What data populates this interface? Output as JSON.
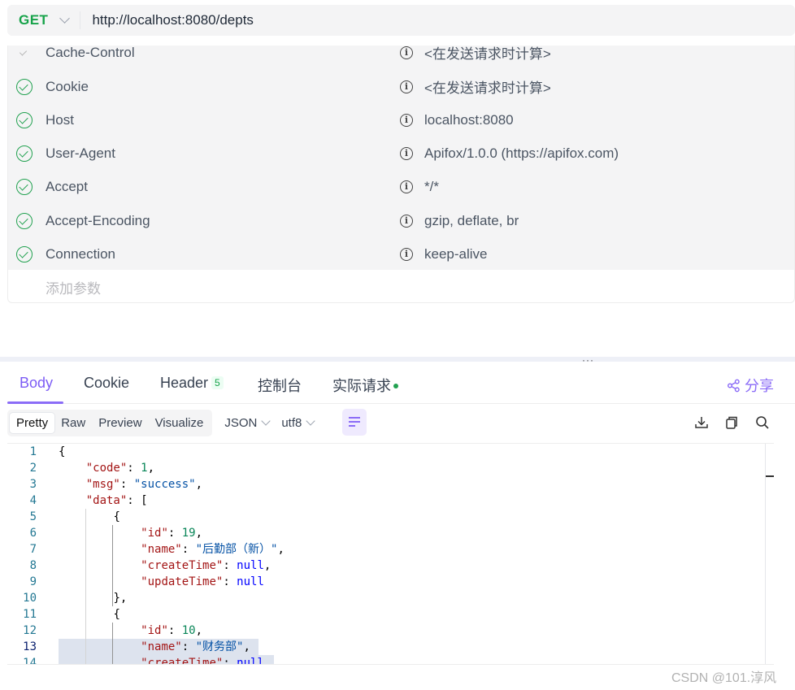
{
  "request": {
    "method": "GET",
    "url": "http://localhost:8080/depts"
  },
  "headers": [
    {
      "key": "Cache-Control",
      "value": "<在发送请求时计算>"
    },
    {
      "key": "Cookie",
      "value": "<在发送请求时计算>"
    },
    {
      "key": "Host",
      "value": "localhost:8080"
    },
    {
      "key": "User-Agent",
      "value": "Apifox/1.0.0 (https://apifox.com)"
    },
    {
      "key": "Accept",
      "value": "*/*"
    },
    {
      "key": "Accept-Encoding",
      "value": "gzip, deflate, br"
    },
    {
      "key": "Connection",
      "value": "keep-alive"
    }
  ],
  "add_param_placeholder": "添加参数",
  "info_glyph": "i",
  "splitter_grip": "···",
  "response_tabs": {
    "body": "Body",
    "cookie": "Cookie",
    "header": "Header",
    "header_count": "5",
    "console": "控制台",
    "actual_request": "实际请求"
  },
  "share_label": "分享",
  "view_modes": [
    "Pretty",
    "Raw",
    "Preview",
    "Visualize"
  ],
  "format_select": "JSON",
  "encoding_select": "utf8",
  "line_numbers": [
    "1",
    "2",
    "3",
    "4",
    "5",
    "6",
    "7",
    "8",
    "9",
    "10",
    "11",
    "12",
    "13",
    "14"
  ],
  "code": {
    "l1": "{",
    "code_key": "\"code\"",
    "code_val": "1",
    "msg_key": "\"msg\"",
    "msg_val": "\"success\"",
    "data_key": "\"data\"",
    "open_bracket": "[",
    "obj_open": "{",
    "id_key": "\"id\"",
    "id1": "19",
    "name_key": "\"name\"",
    "name1": "\"后勤部（新）\"",
    "create_key": "\"createTime\"",
    "null_val": "null",
    "update_key": "\"updateTime\"",
    "obj_close_comma": "},",
    "id2": "10",
    "name2": "\"财务部\""
  },
  "watermark": "CSDN @101.淳风",
  "colors": {
    "accent": "#8b6cf7",
    "method_get": "#17a34a",
    "check": "#22a150"
  }
}
